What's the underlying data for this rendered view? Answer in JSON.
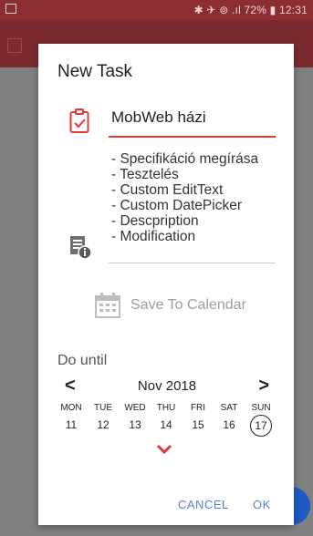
{
  "status_bar": {
    "right_text": "✱ ✈ ⊚ .ıl 72% ▮ 12:31"
  },
  "dialog": {
    "title": "New Task",
    "name_value": "MobWeb házi",
    "description_lines": [
      "- Specifikáció megírása",
      "- Tesztelés",
      "- Custom EditText",
      "- Custom DatePicker",
      "- Descpription",
      "- Modification"
    ],
    "save_to_calendar_label": "Save To Calendar",
    "do_until_label": "Do until",
    "calendar": {
      "month_label": "Nov 2018",
      "prev_label": "<",
      "next_label": ">",
      "days": [
        {
          "name": "MON",
          "date": "11"
        },
        {
          "name": "TUE",
          "date": "12"
        },
        {
          "name": "WED",
          "date": "13"
        },
        {
          "name": "THU",
          "date": "14"
        },
        {
          "name": "FRI",
          "date": "15"
        },
        {
          "name": "SAT",
          "date": "16"
        },
        {
          "name": "SUN",
          "date": "17"
        }
      ],
      "selected_date": "17"
    },
    "cancel_label": "CANCEL",
    "ok_label": "OK"
  },
  "icons": {
    "task": "clipboard-check-icon",
    "info": "document-info-icon",
    "calendar": "calendar-icon",
    "expand": "chevron-down-icon"
  },
  "colors": {
    "accent": "#e53935",
    "primary_dark": "#8c2d32",
    "button_text": "#5c7fd6",
    "fab": "#1e5bc6"
  }
}
